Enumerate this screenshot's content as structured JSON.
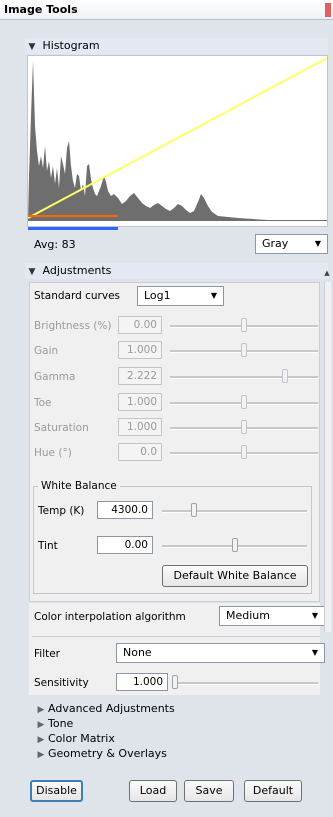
{
  "window": {
    "title": "Image Tools"
  },
  "histogram": {
    "section_title": "Histogram",
    "avg_text": "Avg: 83",
    "channel_selected": "Gray"
  },
  "adjustments": {
    "section_title": "Adjustments",
    "curve_label": "Standard curves",
    "curve_selected": "Log1",
    "sliders": [
      {
        "label": "Brightness (%)",
        "value": "0.00",
        "level": 0.5
      },
      {
        "label": "Gain",
        "value": "1.000",
        "level": 0.5
      },
      {
        "label": "Gamma",
        "value": "2.222",
        "level": 0.78
      },
      {
        "label": "Toe",
        "value": "1.000",
        "level": 0.5
      },
      {
        "label": "Saturation",
        "value": "1.000",
        "level": 0.5
      },
      {
        "label": "Hue (°)",
        "value": "0.0",
        "level": 0.5
      }
    ],
    "white_balance": {
      "group_title": "White Balance",
      "temp_label": "Temp (K)",
      "temp_value": "4300.0",
      "temp_level": 0.22,
      "tint_label": "Tint",
      "tint_value": "0.00",
      "tint_level": 0.5,
      "default_button": "Default White Balance"
    },
    "interp_label": "Color interpolation algorithm",
    "interp_selected": "Medium",
    "filter_label": "Filter",
    "filter_selected": "None",
    "sensitivity_label": "Sensitivity",
    "sensitivity_value": "1.000",
    "sensitivity_level": 0.0
  },
  "subsections": [
    "Advanced Adjustments",
    "Tone",
    "Color Matrix",
    "Geometry & Overlays"
  ],
  "buttons": {
    "disable": "Disable",
    "load": "Load",
    "save": "Save",
    "default": "Default"
  },
  "colors": {
    "curve_line": "#ffff66",
    "histogram_fill": "#6e6e6e",
    "blue_bar": "#3366ff",
    "orange_bar": "#ff6600",
    "default_button_border": "#3c7fb1"
  }
}
